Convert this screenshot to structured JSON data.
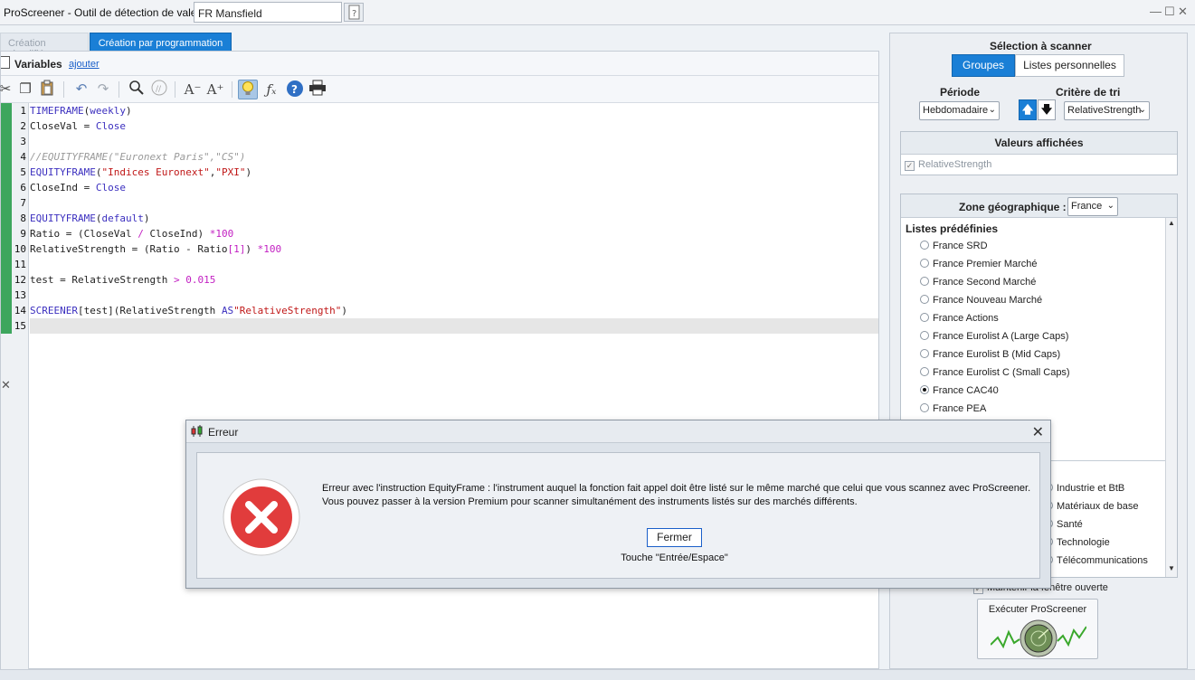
{
  "window": {
    "title": "ProScreener - Outil de détection de valeurs",
    "screener_name": "FR Mansfield"
  },
  "tabs": {
    "simple": "Création simplifiée",
    "programming": "Création par programmation"
  },
  "variables": {
    "label": "Variables",
    "add_link": "ajouter"
  },
  "toolbar": {
    "icons": [
      "scissors-icon",
      "copy-icon",
      "paste-icon",
      "undo-icon",
      "redo-icon",
      "search-icon",
      "comment-icon",
      "font-decrease-icon",
      "font-increase-icon",
      "lightbulb-icon",
      "function-icon",
      "help-icon",
      "print-icon"
    ]
  },
  "editor": {
    "line_numbers": [
      "1",
      "2",
      "3",
      "4",
      "5",
      "6",
      "7",
      "8",
      "9",
      "10",
      "11",
      "12",
      "13",
      "14",
      "15"
    ],
    "lines": {
      "l1": {
        "kw1": "TIMEFRAME",
        "p1": "(",
        "a1": "weekly",
        "p2": ")"
      },
      "l2": {
        "t1": "CloseVal = ",
        "k1": "Close"
      },
      "l4": {
        "c1": "//EQUITYFRAME(\"Euronext Paris\",\"CS\")"
      },
      "l5": {
        "kw1": "EQUITYFRAME",
        "p1": "(",
        "s1": "\"Indices Euronext\"",
        "p2": ",",
        "s2": "\"PXI\"",
        "p3": ")"
      },
      "l6": {
        "t1": "CloseInd = ",
        "k1": "Close"
      },
      "l8": {
        "kw1": "EQUITYFRAME",
        "p1": "(",
        "a1": "default",
        "p2": ")"
      },
      "l9": {
        "t1": "Ratio = (CloseVal ",
        "o1": "/",
        "t2": " CloseInd) ",
        "n1": "*100"
      },
      "l10": {
        "t1": "RelativeStrength = (Ratio - Ratio",
        "n1": "[1]",
        "t2": ") ",
        "n2": "*100"
      },
      "l12": {
        "t1": "test = RelativeStrength ",
        "n1": "> 0.015"
      },
      "l14": {
        "kw1": "SCREENER",
        "t1": "[test](RelativeStrength ",
        "k1": "AS",
        "s1": "\"RelativeStrength\"",
        "t2": ")"
      }
    }
  },
  "right": {
    "selection_title": "Sélection à scanner",
    "btn_groups": "Groupes",
    "btn_lists": "Listes personnelles",
    "period_label": "Période",
    "period_value": "Hebdomadaire",
    "sort_label": "Critère de tri",
    "sort_value": "RelativeStrength",
    "values_title": "Valeurs affichées",
    "values_item": "RelativeStrength",
    "geo_label": "Zone géographique :",
    "geo_value": "France",
    "predefined_title": "Listes prédéfinies",
    "predefined": [
      "France SRD",
      "France Premier Marché",
      "France Second Marché",
      "France Nouveau Marché",
      "France Actions",
      "France Eurolist A (Large Caps)",
      "France Eurolist B (Mid Caps)",
      "France Eurolist C (Small Caps)",
      "France CAC40",
      "France PEA"
    ],
    "selected_index": 8,
    "sectors": [
      "Industrie et BtB",
      "Matériaux de base",
      "Santé",
      "Technologie",
      "Télécommunications"
    ],
    "keep_open": "Maintenir la fenêtre ouverte",
    "run_label": "Exécuter ProScreener"
  },
  "dialog": {
    "title": "Erreur",
    "message_line1": "Erreur avec l'instruction EquityFrame : l'instrument auquel la fonction fait appel doit être listé sur le même marché que celui que vous scannez avec ProScreener.",
    "message_line2": "Vous pouvez passer à la version Premium pour scanner simultanément des instruments listés sur des marchés différents.",
    "close_button": "Fermer",
    "close_hint": "Touche \"Entrée/Espace\""
  },
  "colors": {
    "accent": "#1a7fd6",
    "error": "#e03a3a",
    "line_marker": "#3da65d"
  }
}
